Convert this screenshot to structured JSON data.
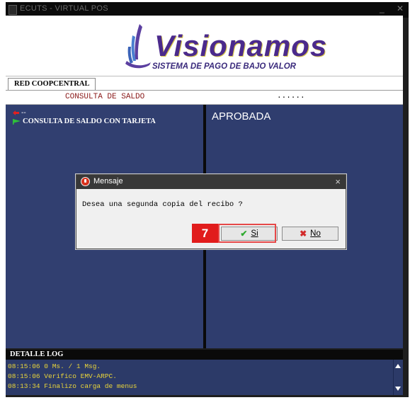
{
  "window": {
    "title": "ECUTS - VIRTUAL POS",
    "minimize_glyph": "_",
    "close_glyph": "✕"
  },
  "logo": {
    "brand": "Visionamos",
    "tagline": "SISTEMA DE PAGO DE BAJO VALOR"
  },
  "tabs": [
    {
      "label": "RED COOPCENTRAL",
      "active": true
    }
  ],
  "infobar": {
    "operation": "CONSULTA  DE  SALDO",
    "progress_dots": "......"
  },
  "menu": {
    "back_label": "--",
    "item_label": "CONSULTA DE SALDO CON TARJETA"
  },
  "result": {
    "status": "APROBADA"
  },
  "log": {
    "header": "DETALLE LOG",
    "lines": [
      "08:15:06 0 Ms. / 1 Msg.",
      "08:15:06 Verifico EMV-ARPC.",
      "08:13:34 Finalizo carga de menus"
    ]
  },
  "dialog": {
    "title": "Mensaje",
    "close_glyph": "×",
    "message": "Desea una segunda copia del recibo ?",
    "yes_label": "Si",
    "no_label": "No",
    "yes_icon": "check-icon",
    "no_icon": "x-mark-icon"
  },
  "annotation": {
    "step": "7"
  },
  "colors": {
    "pane_bg": "#313f70",
    "log_text": "#e8d43a",
    "operation_text": "#8a1a1a",
    "annotation_red": "#e11c1c",
    "dialog_titlebar": "#383838"
  }
}
